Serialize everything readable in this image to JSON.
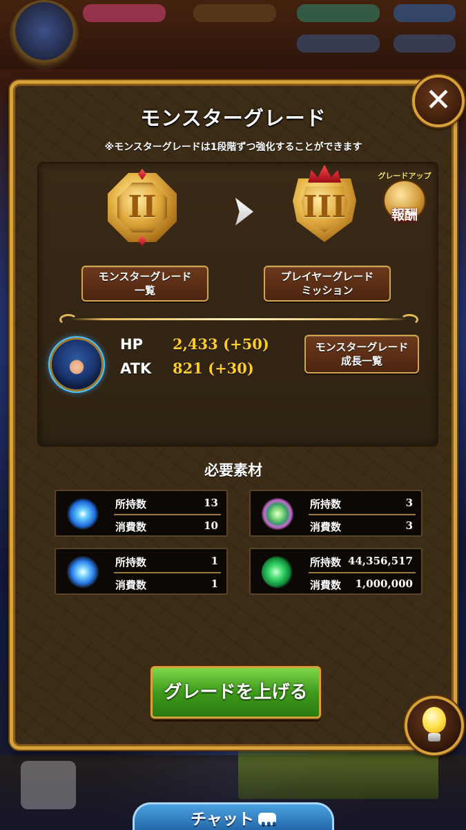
{
  "dialog": {
    "title": "モンスターグレード",
    "subtitle": "※モンスターグレードは1段階ずつ強化することができます",
    "close_symbol": "✕"
  },
  "grades": {
    "current": "II",
    "next": "III"
  },
  "reward_badge": {
    "label": "グレードアップ",
    "text": "報酬"
  },
  "buttons": {
    "grade_list_line1": "モンスターグレード",
    "grade_list_line2": "一覧",
    "mission_line1": "プレイヤーグレード",
    "mission_line2": "ミッション",
    "growth_line1": "モンスターグレード",
    "growth_line2": "成長一覧",
    "grade_up": "グレードを上げる"
  },
  "stats": {
    "hp_label": "HP",
    "hp_value": "2,433 (+50)",
    "atk_label": "ATK",
    "atk_value": "821 (+30)"
  },
  "materials": {
    "title": "必要素材",
    "owned_label": "所持数",
    "cost_label": "消費数",
    "items": [
      {
        "icon": "blue-orb-icon",
        "owned": "13",
        "cost": "10"
      },
      {
        "icon": "flower-crystal-icon",
        "owned": "3",
        "cost": "3"
      },
      {
        "icon": "blue-spark-icon",
        "owned": "1",
        "cost": "1"
      },
      {
        "icon": "green-potion-icon",
        "owned": "44,356,517",
        "cost": "1,000,000"
      }
    ]
  },
  "chat_tab": {
    "label": "チャット"
  },
  "colors": {
    "panel_gold": "#d8a23a",
    "stat_value": "#ffcd2a",
    "grade_up_green": "#3f9a1c"
  }
}
